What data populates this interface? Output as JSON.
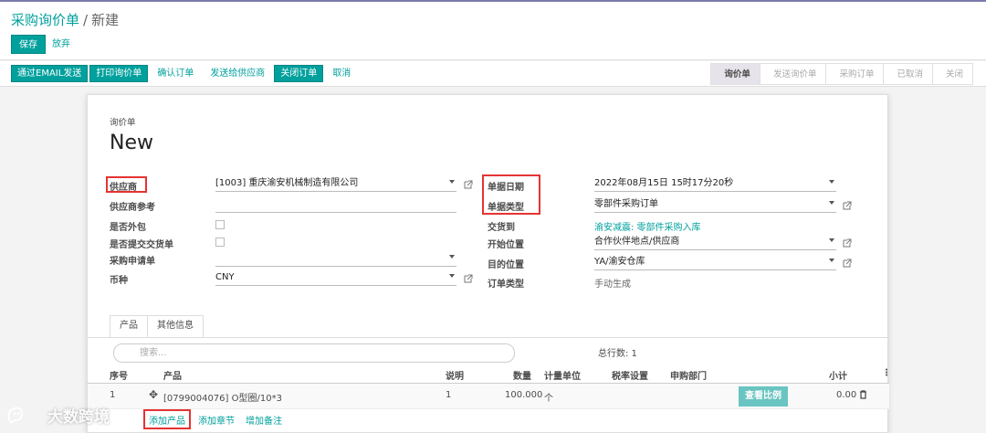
{
  "breadcrumb": {
    "parent": "采购询价单",
    "separator": "/",
    "current": "新建"
  },
  "actions": {
    "save": "保存",
    "discard": "放弃"
  },
  "statusbar_buttons": [
    {
      "label": "通过EMAIL发送",
      "style": "primary"
    },
    {
      "label": "打印询价单",
      "style": "primary"
    },
    {
      "label": "确认订单",
      "style": "link"
    },
    {
      "label": "发送给供应商",
      "style": "link"
    },
    {
      "label": "关闭订单",
      "style": "primary"
    },
    {
      "label": "取消",
      "style": "link"
    }
  ],
  "stages": [
    {
      "label": "询价单",
      "active": true
    },
    {
      "label": "发送询价单",
      "active": false
    },
    {
      "label": "采购订单",
      "active": false
    },
    {
      "label": "已取消",
      "active": false
    },
    {
      "label": "关闭",
      "active": false
    }
  ],
  "form": {
    "subtitle": "询价单",
    "title": "New",
    "left": {
      "vendor_label": "供应商",
      "vendor_value": "[1003] 重庆渝安机械制造有限公司",
      "vendor_ref_label": "供应商参考",
      "vendor_ref_value": "",
      "outsource_label": "是否外包",
      "submit_delivery_label": "是否提交交货单",
      "requisition_label": "采购申请单",
      "requisition_value": "",
      "currency_label": "币种",
      "currency_value": "CNY"
    },
    "right": {
      "date_label": "单据日期",
      "date_value": "2022年08月15日 15时17分20秒",
      "type_label": "单据类型",
      "type_value": "零部件采购订单",
      "deliver_to_label": "交货到",
      "deliver_to_value": "渝安减震: 零部件采购入库",
      "src_location_label": "开始位置",
      "src_location_value": "合作伙伴地点/供应商",
      "dest_location_label": "目的位置",
      "dest_location_value": "YA/渝安仓库",
      "order_type_label": "订单类型",
      "order_type_value": "手动生成"
    }
  },
  "tabs": [
    "产品",
    "其他信息"
  ],
  "lines": {
    "search_placeholder": "搜索...",
    "total_rows": "总行数: 1",
    "headers": [
      "序号",
      "产品",
      "说明",
      "数量",
      "计量单位",
      "税率设置",
      "申购部门",
      "小计"
    ],
    "rows": [
      {
        "seq": "1",
        "product": "[0799004076] O型圈/10*3",
        "desc": "1",
        "qty": "100.000",
        "uom": "个",
        "ratio_button": "查看比例",
        "subtotal": "0.00"
      }
    ],
    "add_product": "添加产品",
    "add_section": "添加章节",
    "add_note": "增加备注"
  },
  "watermark": "大数跨境",
  "colors": {
    "accent": "#00a09d",
    "highlight": "#e63333",
    "brand": "#7c7bad"
  }
}
